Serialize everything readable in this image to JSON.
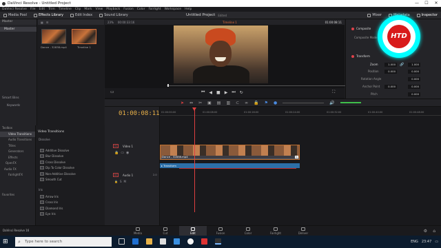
{
  "window": {
    "title": "DaVinci Resolve - Untitled Project",
    "min": "—",
    "max": "☐",
    "close": "✕"
  },
  "menu": [
    "DaVinci Resolve",
    "File",
    "Edit",
    "Trim",
    "Timeline",
    "Clip",
    "Mark",
    "View",
    "Playback",
    "Fusion",
    "Color",
    "Fairlight",
    "Workspace",
    "Help"
  ],
  "toolbar": {
    "media_pool": "Media Pool",
    "effects_library": "Effects Library",
    "edit_index": "Edit Index",
    "sound_library": "Sound Library",
    "mixer": "Mixer",
    "metadata": "Metadata",
    "inspector": "Inspector"
  },
  "project_title": "Untitled Project",
  "project_status": "Edited",
  "bins": {
    "header": "Master",
    "items": [
      "Master"
    ],
    "smart_bins_label": "Smart Bins",
    "smart_items": [
      "Keywords"
    ]
  },
  "mediapool": {
    "zoom": "23%",
    "timecode": "00:00:33:16",
    "clips": [
      {
        "name": "Dance - 32838.mp4",
        "selected": false
      },
      {
        "name": "Timeline 1",
        "selected": true
      }
    ]
  },
  "viewer": {
    "timeline_name": "Timeline 1",
    "timecode": "01:00:08:11"
  },
  "inspector": {
    "composite_label": "Composite",
    "composite_mode_label": "Composite Mode",
    "transform_label": "Transform",
    "zoom_label": "Zoom",
    "zoom_x": "1.000",
    "zoom_y": "1.000",
    "position_label": "Position",
    "position_x": "0.000",
    "position_y": "0.000",
    "rotation_label": "Rotation Angle",
    "rotation": "0.000",
    "anchor_label": "Anchor Point",
    "anchor_x": "0.000",
    "anchor_y": "0.000",
    "pitch_label": "Pitch",
    "pitch": "0.000"
  },
  "watermark": "HTD",
  "fx_nav": {
    "toolbox": "Toolbox",
    "items": [
      "Video Transitions",
      "Audio Transitions",
      "Titles",
      "Generators",
      "Effects",
      "OpenFX",
      "Audio FX",
      "FairlightFX"
    ],
    "favorites": "Favorites"
  },
  "fx_list": {
    "title": "Video Transitions",
    "dissolve_header": "Dissolve",
    "dissolve": [
      "Additive Dissolve",
      "Blur Dissolve",
      "Cross Dissolve",
      "Dip To Color Dissolve",
      "Non-Additive Dissolve",
      "Smooth Cut"
    ],
    "iris_header": "Iris",
    "iris": [
      "Arrow Iris",
      "Cross Iris",
      "Diamond Iris",
      "Eye Iris"
    ]
  },
  "timeline": {
    "timecode": "01:00:08:11",
    "ruler": [
      "01:00:00:00",
      "01:00:08:00",
      "01:00:16:00",
      "01:00:24:00",
      "01:00:32:00",
      "01:00:40:00",
      "01:00:48:00",
      "01:00:56:00"
    ],
    "v1_badge": "V1",
    "v1_name": "Video 1",
    "a1_badge": "A1",
    "a1_name": "Audio 1",
    "a1_level": "2.0",
    "clip_name": "Dance - 32838.mp4",
    "transform_bar": "Transform",
    "clip_count": "1 Clip"
  },
  "pages": [
    "Media",
    "Cut",
    "Edit",
    "Fusion",
    "Color",
    "Fairlight",
    "Deliver"
  ],
  "active_page": "Edit",
  "app_footer": "DaVinci Resolve 16",
  "taskbar": {
    "search_placeholder": "Type here to search",
    "lang": "ENG",
    "time": "23:47"
  }
}
